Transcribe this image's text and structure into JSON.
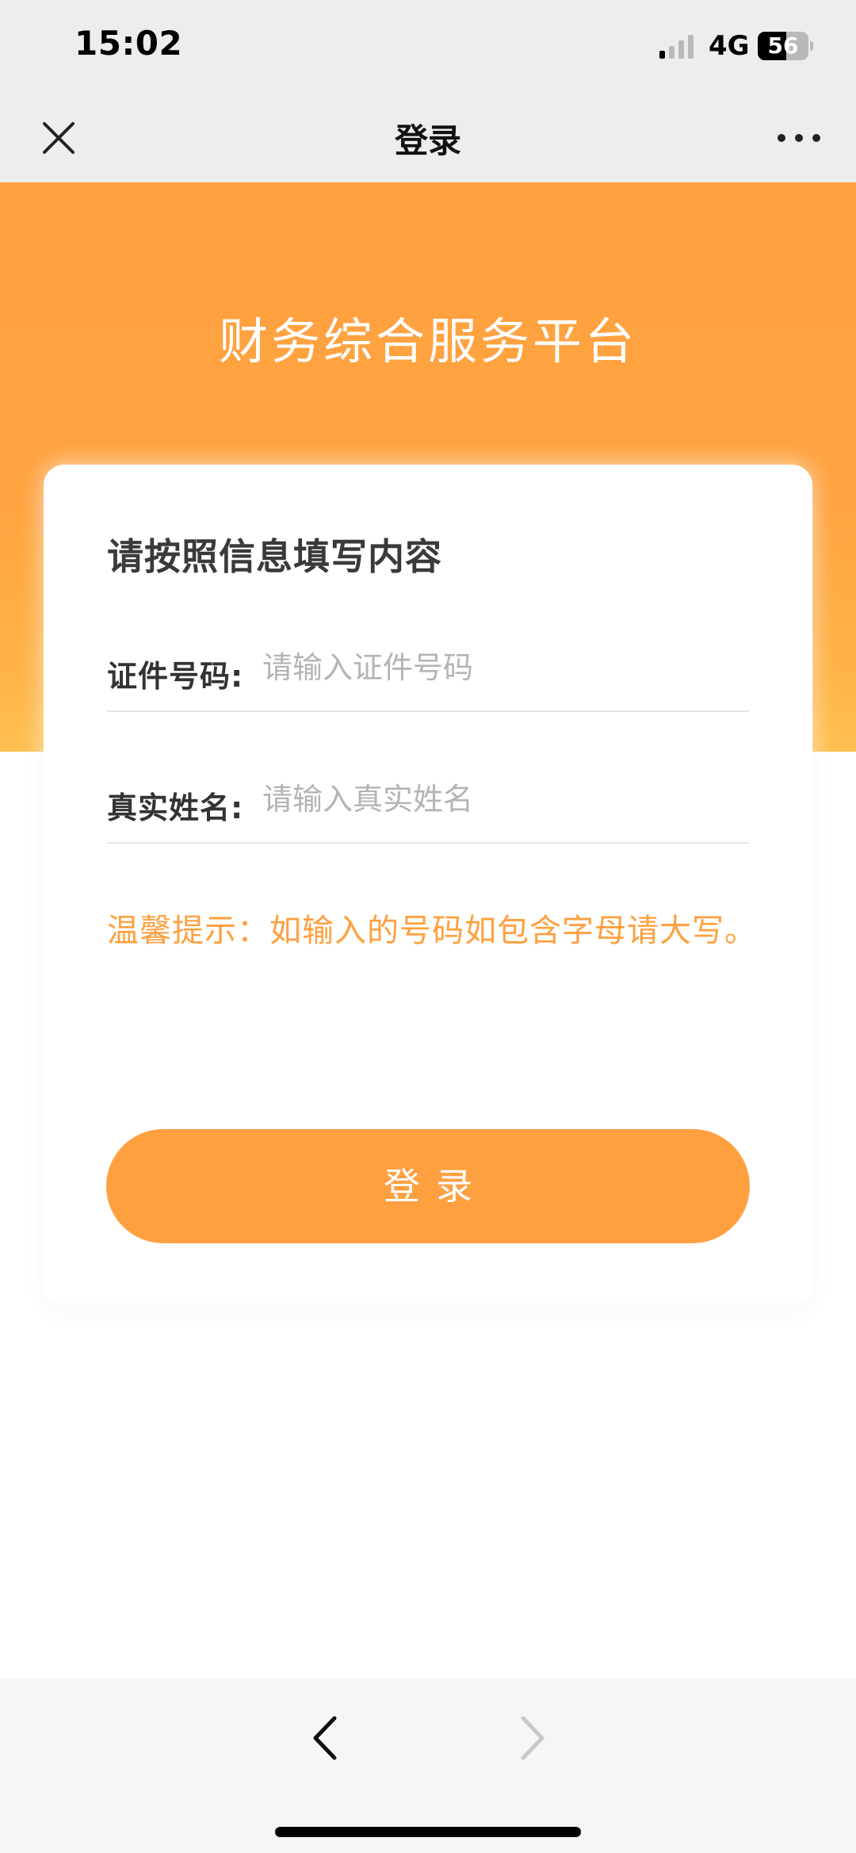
{
  "status_bar": {
    "time": "15:02",
    "network": "4G",
    "battery_level": "56",
    "battery_fraction": 0.56,
    "icons": [
      "signal-icon",
      "battery-icon"
    ]
  },
  "nav": {
    "title": "登录",
    "icons": [
      "close-icon",
      "more-icon"
    ]
  },
  "hero": {
    "title": "财务综合服务平台"
  },
  "form": {
    "heading": "请按照信息填写内容",
    "id_label": "证件号码:",
    "id_placeholder": "请输入证件号码",
    "id_value": "",
    "name_label": "真实姓名:",
    "name_placeholder": "请输入真实姓名",
    "name_value": "",
    "tip": "温馨提示：如输入的号码如包含字母请大写。",
    "submit_label": "登录"
  },
  "toolbar": {
    "icons": [
      "chevron-left-icon",
      "chevron-right-icon"
    ]
  },
  "colors": {
    "accent": "#ffa040",
    "header_bg": "#ededed",
    "tip_text": "#ffa03f",
    "disabled_arrow": "#c8c8c8"
  }
}
